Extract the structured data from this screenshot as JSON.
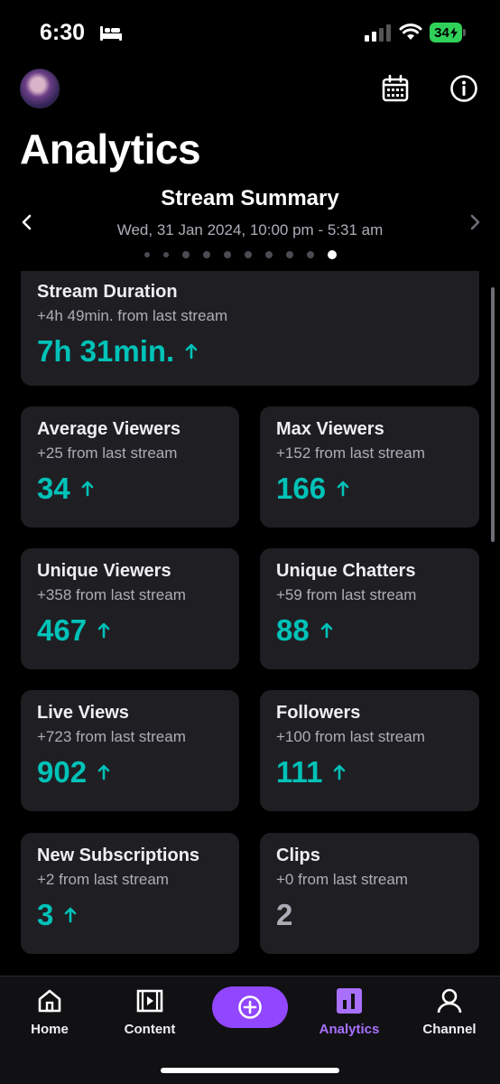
{
  "status_bar": {
    "time": "6:30",
    "battery": "34"
  },
  "header": {
    "title": "Analytics"
  },
  "summary": {
    "title": "Stream Summary",
    "date_range": "Wed, 31 Jan 2024, 10:00 pm - 5:31 am",
    "page_count": 10,
    "active_page": 10
  },
  "cards": {
    "duration": {
      "title": "Stream Duration",
      "delta": "+4h 49min. from last stream",
      "value": "7h 31min.",
      "trend": "up"
    },
    "avg_viewers": {
      "title": "Average Viewers",
      "delta": "+25 from last stream",
      "value": "34",
      "trend": "up"
    },
    "max_viewers": {
      "title": "Max Viewers",
      "delta": "+152 from last stream",
      "value": "166",
      "trend": "up"
    },
    "unique_viewers": {
      "title": "Unique Viewers",
      "delta": "+358 from last stream",
      "value": "467",
      "trend": "up"
    },
    "unique_chatters": {
      "title": "Unique Chatters",
      "delta": "+59 from last stream",
      "value": "88",
      "trend": "up"
    },
    "live_views": {
      "title": "Live Views",
      "delta": "+723 from last stream",
      "value": "902",
      "trend": "up"
    },
    "followers": {
      "title": "Followers",
      "delta": "+100 from last stream",
      "value": "111",
      "trend": "up"
    },
    "new_subs": {
      "title": "New Subscriptions",
      "delta": "+2 from last stream",
      "value": "3",
      "trend": "up"
    },
    "clips": {
      "title": "Clips",
      "delta": "+0 from last stream",
      "value": "2",
      "trend": "none"
    }
  },
  "tabs": {
    "home": "Home",
    "content": "Content",
    "analytics": "Analytics",
    "channel": "Channel"
  },
  "icons": {
    "calendar": "calendar-icon",
    "info": "info-icon",
    "trend_up": "arrow-up-icon",
    "create": "plus-circle-icon"
  },
  "colors": {
    "accent_teal": "#00c2b8",
    "brand_purple": "#9147ff",
    "active_tab": "#a970ff",
    "card_bg": "#1f1f23"
  }
}
